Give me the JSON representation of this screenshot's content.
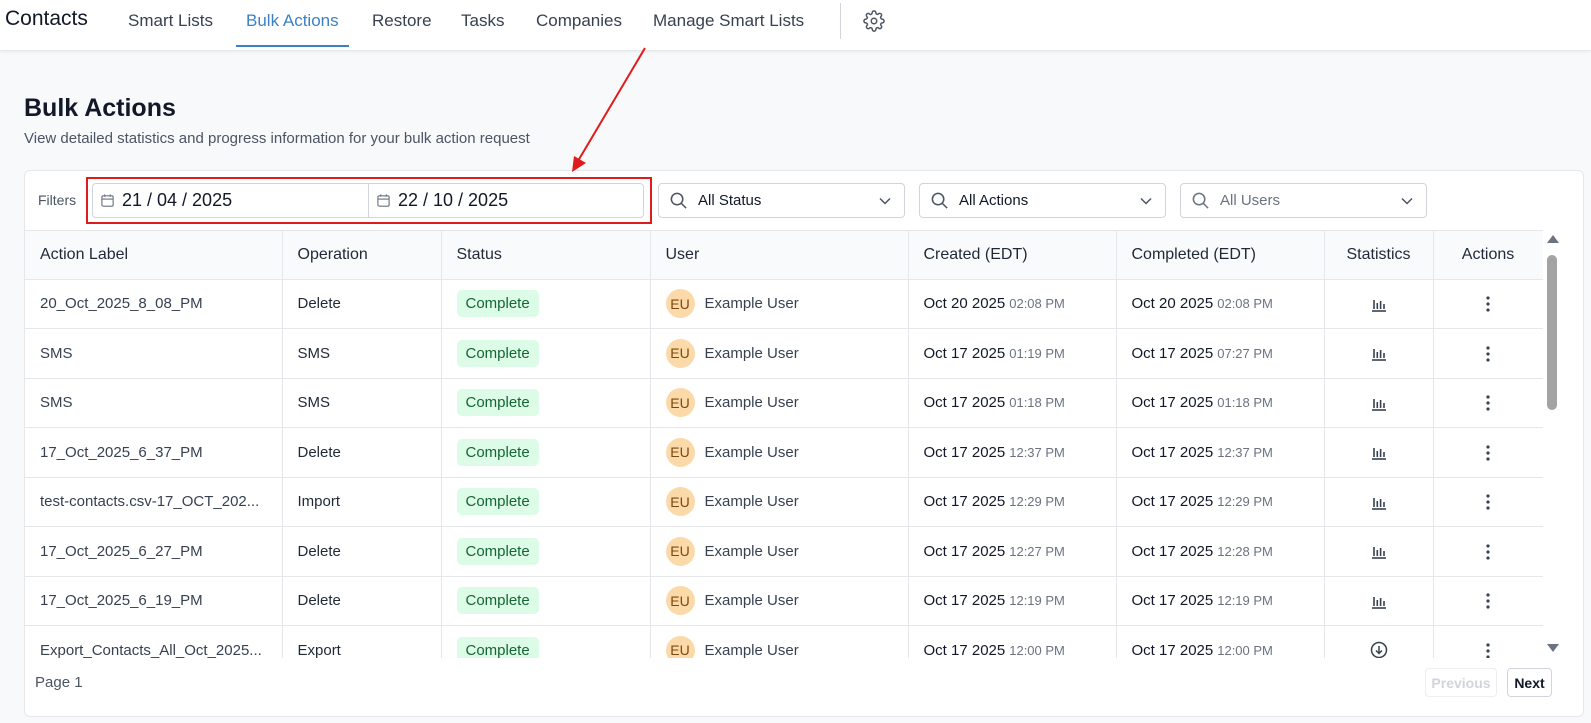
{
  "nav": {
    "brand": "Contacts",
    "tabs": [
      {
        "label": "Smart Lists",
        "active": false
      },
      {
        "label": "Bulk Actions",
        "active": true
      },
      {
        "label": "Restore",
        "active": false
      },
      {
        "label": "Tasks",
        "active": false
      },
      {
        "label": "Companies",
        "active": false
      },
      {
        "label": "Manage Smart Lists",
        "active": false
      }
    ],
    "settings_icon": "gear-icon",
    "active_color": "#3b82c4"
  },
  "page": {
    "title": "Bulk Actions",
    "subtitle": "View detailed statistics and progress information for your bulk action request"
  },
  "filters": {
    "label": "Filters",
    "date_start": "21 / 04 / 2025",
    "date_end": "22 / 10 / 2025",
    "status": "All Status",
    "actions": "All Actions",
    "users": "All Users",
    "highlight_color": "#e01b1b"
  },
  "table": {
    "headers": [
      "Action Label",
      "Operation",
      "Status",
      "User",
      "Created (EDT)",
      "Completed (EDT)",
      "Statistics",
      "Actions"
    ],
    "rows": [
      {
        "label": "20_Oct_2025_8_08_PM",
        "operation": "Delete",
        "status": "Complete",
        "initials": "EU",
        "user": "Example User",
        "created_date": "Oct 20 2025",
        "created_time": "02:08 PM",
        "completed_date": "Oct 20 2025",
        "completed_time": "02:08 PM",
        "stat_icon": "bar-chart-icon"
      },
      {
        "label": "SMS",
        "operation": "SMS",
        "status": "Complete",
        "initials": "EU",
        "user": "Example User",
        "created_date": "Oct 17 2025",
        "created_time": "01:19 PM",
        "completed_date": "Oct 17 2025",
        "completed_time": "07:27 PM",
        "stat_icon": "bar-chart-icon"
      },
      {
        "label": "SMS",
        "operation": "SMS",
        "status": "Complete",
        "initials": "EU",
        "user": "Example User",
        "created_date": "Oct 17 2025",
        "created_time": "01:18 PM",
        "completed_date": "Oct 17 2025",
        "completed_time": "01:18 PM",
        "stat_icon": "bar-chart-icon"
      },
      {
        "label": "17_Oct_2025_6_37_PM",
        "operation": "Delete",
        "status": "Complete",
        "initials": "EU",
        "user": "Example User",
        "created_date": "Oct 17 2025",
        "created_time": "12:37 PM",
        "completed_date": "Oct 17 2025",
        "completed_time": "12:37 PM",
        "stat_icon": "bar-chart-icon"
      },
      {
        "label": "test-contacts.csv-17_OCT_202...",
        "operation": "Import",
        "status": "Complete",
        "initials": "EU",
        "user": "Example User",
        "created_date": "Oct 17 2025",
        "created_time": "12:29 PM",
        "completed_date": "Oct 17 2025",
        "completed_time": "12:29 PM",
        "stat_icon": "bar-chart-icon"
      },
      {
        "label": "17_Oct_2025_6_27_PM",
        "operation": "Delete",
        "status": "Complete",
        "initials": "EU",
        "user": "Example User",
        "created_date": "Oct 17 2025",
        "created_time": "12:27 PM",
        "completed_date": "Oct 17 2025",
        "completed_time": "12:28 PM",
        "stat_icon": "bar-chart-icon"
      },
      {
        "label": "17_Oct_2025_6_19_PM",
        "operation": "Delete",
        "status": "Complete",
        "initials": "EU",
        "user": "Example User",
        "created_date": "Oct 17 2025",
        "created_time": "12:19 PM",
        "completed_date": "Oct 17 2025",
        "completed_time": "12:19 PM",
        "stat_icon": "bar-chart-icon"
      },
      {
        "label": "Export_Contacts_All_Oct_2025...",
        "operation": "Export",
        "status": "Complete",
        "initials": "EU",
        "user": "Example User",
        "created_date": "Oct 17 2025",
        "created_time": "12:00 PM",
        "completed_date": "Oct 17 2025",
        "completed_time": "12:00 PM",
        "stat_icon": "download-icon"
      }
    ],
    "badge_color": "#dcfce7",
    "avatar_color": "#fcd9a8"
  },
  "pagination": {
    "page_label": "Page 1",
    "previous": "Previous",
    "next": "Next"
  }
}
